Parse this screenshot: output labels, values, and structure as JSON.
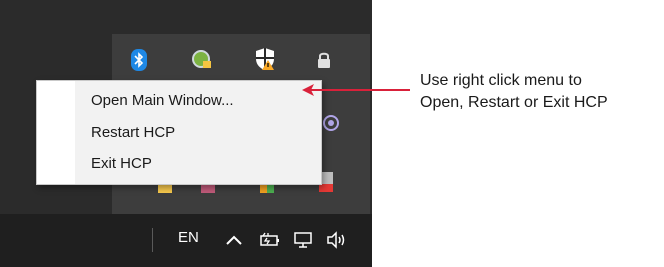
{
  "taskbar": {
    "language": "EN",
    "icons": [
      "show-hidden-icons-caret-icon",
      "battery-icon",
      "network-icon",
      "volume-icon"
    ]
  },
  "tray_flyout": {
    "icons": [
      "bluetooth-icon",
      "monitor-lock-icon",
      "security-shield-icon",
      "lock-icon",
      "circle-app-icon",
      "tray-app-icon-1",
      "tray-app-icon-2",
      "tray-app-icon-3",
      "tray-app-icon-4"
    ]
  },
  "context_menu": {
    "items": [
      {
        "label": "Open Main Window..."
      },
      {
        "label": "Restart HCP"
      },
      {
        "label": "Exit HCP"
      }
    ]
  },
  "annotation": {
    "line1": "Use right click menu to",
    "line2": "Open, Restart or Exit HCP",
    "arrow_color": "#d9213a"
  }
}
